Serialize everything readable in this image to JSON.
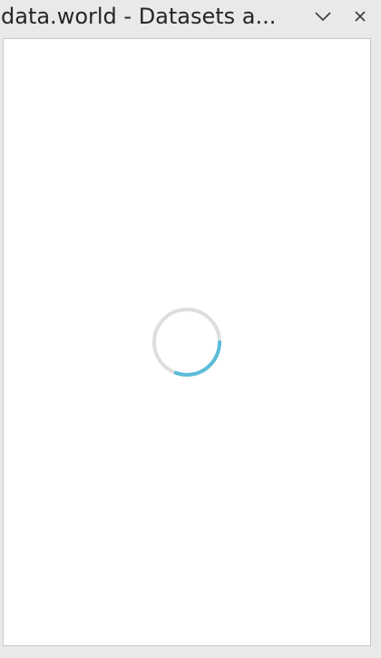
{
  "taskpane": {
    "title": "data.world - Datasets a...",
    "menu_icon": "chevron-down-icon",
    "close_icon": "close-icon"
  },
  "loading": {
    "spinner_icon": "loading-spinner-icon",
    "track_color": "#dedede",
    "accent_color": "#5bbcd9"
  }
}
